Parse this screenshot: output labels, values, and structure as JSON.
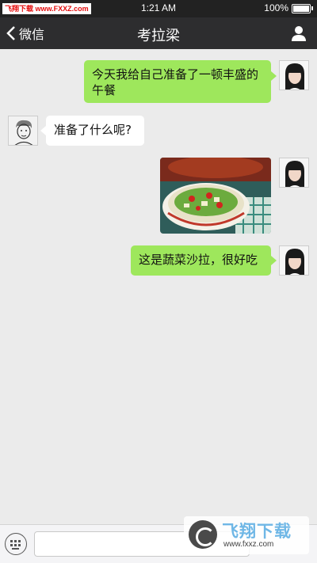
{
  "status_bar": {
    "watermark": "飞翔下载 www.FXXZ.com",
    "time": "1:21 AM",
    "battery": "100%"
  },
  "nav": {
    "back_label": "微信",
    "title": "考拉梁"
  },
  "messages": [
    {
      "side": "right",
      "type": "text",
      "text": "今天我给自己准备了一顿丰盛的午餐"
    },
    {
      "side": "left",
      "type": "text",
      "text": "准备了什么呢?"
    },
    {
      "side": "right",
      "type": "image",
      "alt": "salad-photo"
    },
    {
      "side": "right",
      "type": "text",
      "text": "这是蔬菜沙拉，很好吃"
    }
  ],
  "input_bar": {
    "placeholder": ""
  },
  "watermark_bottom": {
    "brand": "飞翔下载",
    "url": "www.fxxz.com"
  },
  "colors": {
    "nav_bg": "#2d2d2f",
    "chat_bg": "#ebebeb",
    "bubble_out": "#9ee75c",
    "bubble_in": "#ffffff"
  }
}
